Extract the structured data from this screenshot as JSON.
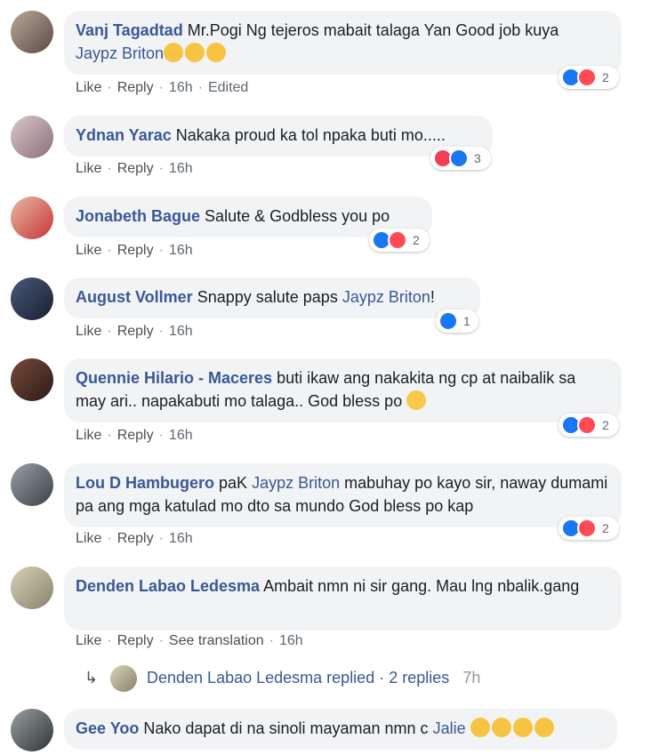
{
  "comments": [
    {
      "author": "Vanj Tagadtad",
      "text_before": "Mr.Pogi Ng tejeros mabait talaga Yan Good job kuya",
      "mention": "Jaypz Briton",
      "emoji": [
        "clap",
        "clap",
        "clap"
      ],
      "actions": {
        "like": "Like",
        "reply": "Reply",
        "time": "16h",
        "edited": "Edited"
      },
      "reactions": {
        "types": [
          "like",
          "haha"
        ],
        "count": "2"
      }
    },
    {
      "author": "Ydnan Yarac",
      "text_before": "Nakaka proud ka tol npaka buti mo.....",
      "actions": {
        "like": "Like",
        "reply": "Reply",
        "time": "16h"
      },
      "reactions": {
        "types": [
          "love",
          "like"
        ],
        "count": "3"
      }
    },
    {
      "author": "Jonabeth Bague",
      "text_before": "Salute & Godbless you po",
      "actions": {
        "like": "Like",
        "reply": "Reply",
        "time": "16h"
      },
      "reactions": {
        "types": [
          "like",
          "haha"
        ],
        "count": "2"
      }
    },
    {
      "author": "August Vollmer",
      "text_before": "Snappy salute paps",
      "mention": "Jaypz Briton",
      "text_after": "!",
      "actions": {
        "like": "Like",
        "reply": "Reply",
        "time": "16h"
      },
      "reactions": {
        "types": [
          "like"
        ],
        "count": "1"
      }
    },
    {
      "author": "Quennie Hilario - Maceres",
      "text_before": "buti ikaw ang nakakita ng cp at naibalik sa may ari.. napakabuti mo talaga.. God bless po",
      "emoji": [
        "smile"
      ],
      "actions": {
        "like": "Like",
        "reply": "Reply",
        "time": "16h"
      },
      "reactions": {
        "types": [
          "like",
          "haha"
        ],
        "count": "2"
      }
    },
    {
      "author": "Lou D Hambugero",
      "text_before": "paK",
      "mention": "Jaypz Briton",
      "text_after": "mabuhay po kayo sir, naway dumami pa ang mga katulad mo dto sa mundo God bless po kap",
      "actions": {
        "like": "Like",
        "reply": "Reply",
        "time": "16h"
      },
      "reactions": {
        "types": [
          "like",
          "haha"
        ],
        "count": "2"
      }
    },
    {
      "author": "Denden Labao Ledesma",
      "text_before": "Ambait nmn ni sir gang. Mau lng nbalik.gang",
      "actions": {
        "like": "Like",
        "reply": "Reply",
        "translation": "See translation",
        "time": "16h"
      },
      "replies": {
        "author": "Denden Labao Ledesma",
        "label": "replied",
        "count_text": "2 replies",
        "time": "7h"
      }
    },
    {
      "author": "Gee Yoo",
      "text_before": "Nako dapat di na sinoli mayaman nmn c",
      "mention": "Jalie",
      "emoji": [
        "laugh",
        "laugh",
        "laugh",
        "laugh"
      ]
    }
  ],
  "colors": {
    "link": "#385898",
    "bubble": "#f2f3f5",
    "like": "#1877f2",
    "haha": "#ff4b55",
    "love": "#f33e58"
  }
}
